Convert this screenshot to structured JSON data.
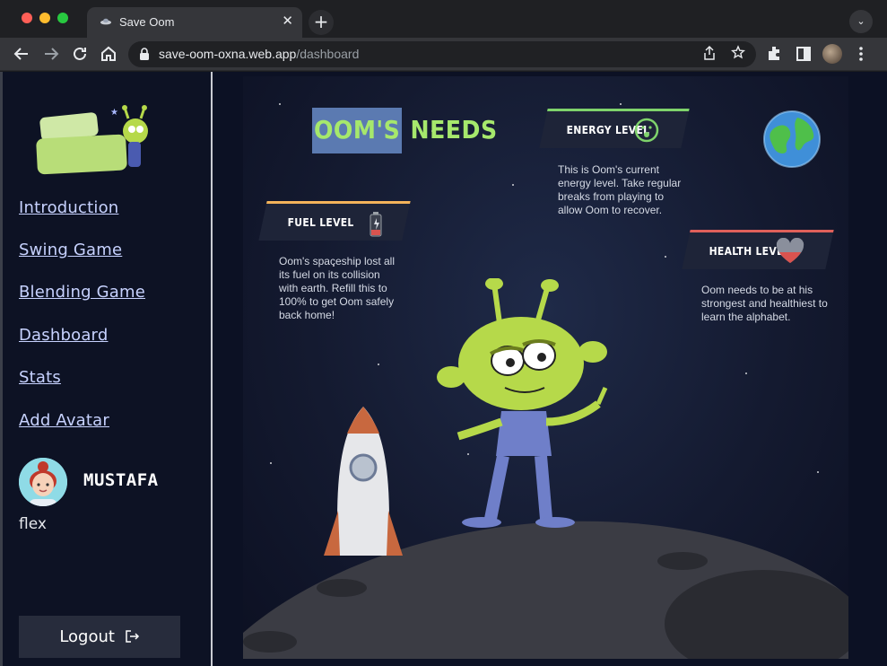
{
  "browser": {
    "tab_title": "Save Oom",
    "tab_close": "✕",
    "new_tab": "+",
    "tab_menu": "⌄",
    "url_host": "save-oom-oxna.web.app",
    "url_path": "/dashboard",
    "icons": [
      "back-icon",
      "forward-icon",
      "reload-icon",
      "home-icon",
      "lock-icon",
      "share-icon",
      "star-icon",
      "extensions-icon",
      "sidepanel-icon",
      "menu-icon"
    ]
  },
  "sidebar": {
    "nav": [
      {
        "label": "Introduction"
      },
      {
        "label": "Swing Game"
      },
      {
        "label": "Blending Game"
      },
      {
        "label": "Dashboard"
      },
      {
        "label": "Stats"
      },
      {
        "label": "Add Avatar"
      }
    ],
    "user": {
      "name": "MUSTAFA",
      "subtitle": "flex"
    },
    "logout_label": "Logout"
  },
  "main": {
    "title_highlight": "OOM'S",
    "title_rest": " NEEDS",
    "cards": {
      "fuel": {
        "label": "FUEL LEVEL",
        "text": "Oom's spaceship lost all its fuel on its collision with earth. Refill this to 100% to get Oom safely back home!",
        "accent": "#f4b35a"
      },
      "energy": {
        "label": "ENERGY LEVEL",
        "text": "This is Oom's current energy level. Take regular breaks from playing to allow Oom to recover.",
        "accent": "#7fd36b"
      },
      "health": {
        "label": "HEALTH LEVEL",
        "text": "Oom needs to be at his strongest and healthiest to learn the alphabet.",
        "accent": "#e0605a"
      }
    }
  },
  "colors": {
    "nav_link": "#c7d2ff",
    "title_green": "#a6e86c",
    "title_highlight_bg": "#5b7ab1",
    "sidebar_bg": "#0d1224",
    "logout_bg": "#272c3c"
  }
}
